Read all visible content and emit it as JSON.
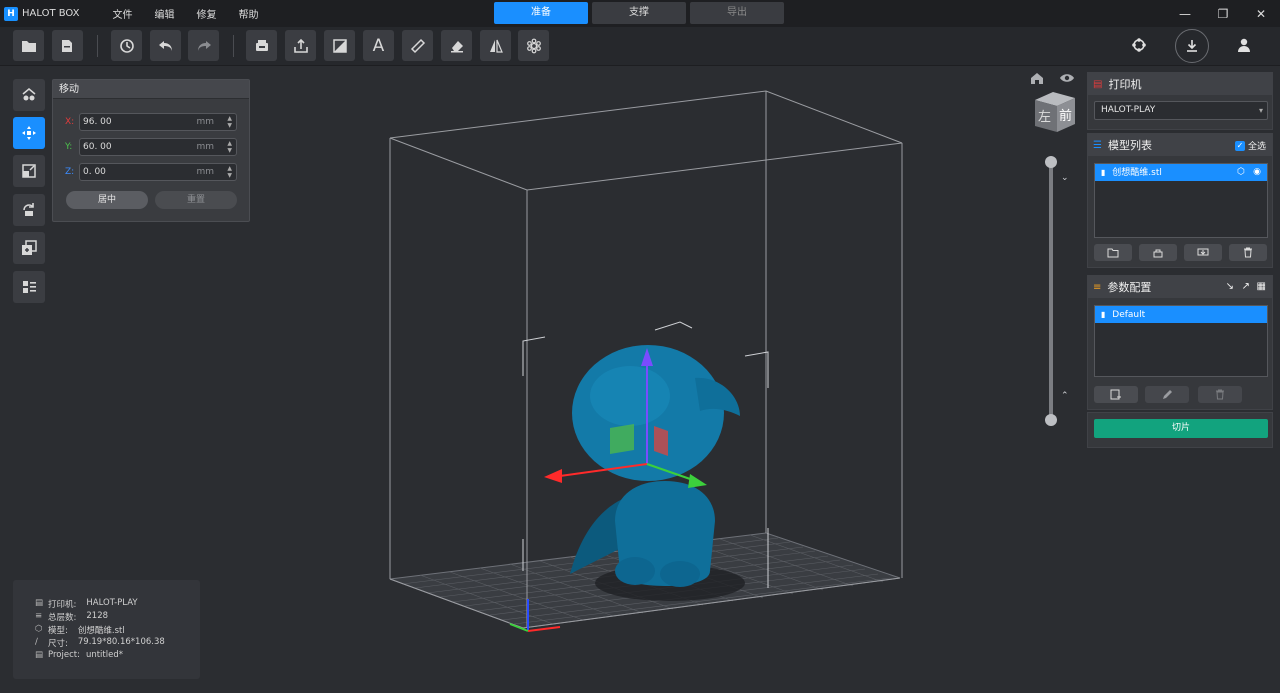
{
  "app": {
    "logo": "H",
    "name": "HALOT BOX"
  },
  "menu": [
    "文件",
    "编辑",
    "修复",
    "帮助"
  ],
  "mode_tabs": [
    {
      "label": "准备",
      "state": "active"
    },
    {
      "label": "支撑",
      "state": "normal"
    },
    {
      "label": "导出",
      "state": "disabled"
    }
  ],
  "window_controls": [
    "minimize-icon",
    "restore-icon",
    "close-icon"
  ],
  "toolbar_icons": [
    "open-folder-icon",
    "open-project-icon",
    "history-icon",
    "undo-icon",
    "redo-icon",
    "print-icon",
    "export-icon",
    "hollow-icon",
    "text-icon",
    "measure-icon",
    "erase-icon",
    "mirror-icon",
    "lattice-icon"
  ],
  "left_tools": [
    "view-icon",
    "move-icon",
    "scale-icon",
    "rotate-icon",
    "duplicate-icon",
    "layout-icon"
  ],
  "move_panel": {
    "title": "移动",
    "x": {
      "label": "X:",
      "value": "96. 00",
      "unit": "mm",
      "color": "#e23b3b"
    },
    "y": {
      "label": "Y:",
      "value": "60. 00",
      "unit": "mm",
      "color": "#4cc24c"
    },
    "z": {
      "label": "Z:",
      "value": "0. 00",
      "unit": "mm",
      "color": "#3b8cff"
    },
    "center_label": "居中",
    "reset_label": "重置"
  },
  "view_cube": {
    "left_face": "左",
    "front_face": "前"
  },
  "printer_panel": {
    "title": "打印机",
    "selected": "HALOT-PLAY"
  },
  "model_list": {
    "title": "模型列表",
    "select_all": "全选",
    "items": [
      "创想酷维.stl"
    ]
  },
  "params": {
    "title": "参数配置",
    "items": [
      "Default"
    ]
  },
  "slice_label": "切片",
  "info": {
    "printer_label": "打印机:",
    "printer_value": "HALOT-PLAY",
    "layers_label": "总层数:",
    "layers_value": "2128",
    "model_label": "模型:",
    "model_value": "创想酷维.stl",
    "size_label": "尺寸:",
    "size_value": "79.19*80.16*106.38",
    "project_label": "Project:",
    "project_value": "untitled*"
  },
  "colors": {
    "accent": "#1a8fff",
    "slice": "#12a37e",
    "model": "#0f6f9a"
  }
}
